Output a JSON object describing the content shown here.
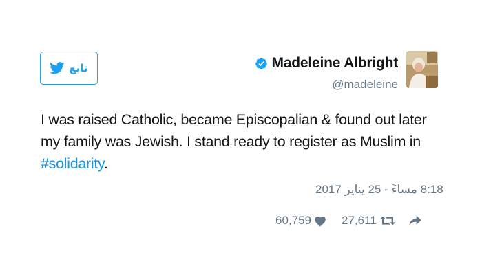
{
  "tweet": {
    "author": {
      "display_name": "Madeleine Albright",
      "handle": "@madeleine",
      "verified": true
    },
    "follow_button": {
      "label": "تابع",
      "icon": "twitter-bird-icon"
    },
    "text": {
      "body": "I was raised Catholic, became Episcopalian & found out later my family was Jewish. I stand ready to register as Muslim in ",
      "hashtag": "#solidarity",
      "trailing": "."
    },
    "timestamp": "8:18 مساءً - 25 يناير 2017",
    "actions": {
      "likes": "60,759",
      "retweets": "27,611",
      "like_icon": "heart-icon",
      "retweet_icon": "retweet-icon",
      "share_icon": "share-arrow-icon"
    },
    "colors": {
      "accent": "#1da1f2",
      "hashtag": "#1b95e0",
      "secondary_text": "#657786",
      "primary_text": "#14171a"
    }
  }
}
